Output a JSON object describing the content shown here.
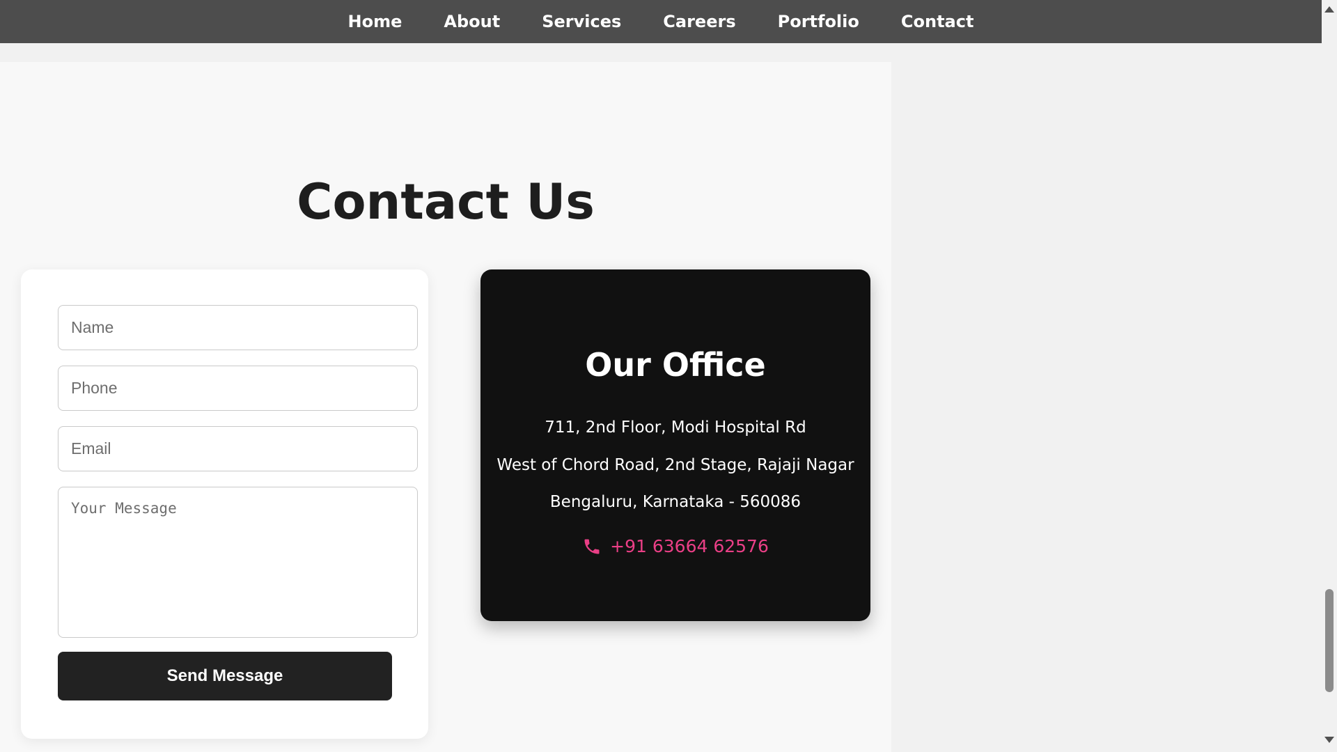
{
  "nav": {
    "items": [
      {
        "label": "Home"
      },
      {
        "label": "About"
      },
      {
        "label": "Services"
      },
      {
        "label": "Careers"
      },
      {
        "label": "Portfolio"
      },
      {
        "label": "Contact"
      }
    ]
  },
  "contact": {
    "title": "Contact Us",
    "form": {
      "name_placeholder": "Name",
      "phone_placeholder": "Phone",
      "email_placeholder": "Email",
      "message_placeholder": "Your Message",
      "submit_label": "Send Message"
    },
    "office": {
      "title": "Our Office",
      "address_line1": "711, 2nd Floor, Modi Hospital Rd",
      "address_line2": "West of Chord Road, 2nd Stage, Rajaji Nagar",
      "address_line3": "Bengaluru, Karnataka - 560086",
      "phone": "+91 63664 62576",
      "phone_icon": "phone-icon"
    }
  },
  "colors": {
    "navbar_bg": "#4d4d4d",
    "accent_pink": "#ea3f86",
    "office_card_bg": "#111111",
    "button_bg": "#222222"
  }
}
